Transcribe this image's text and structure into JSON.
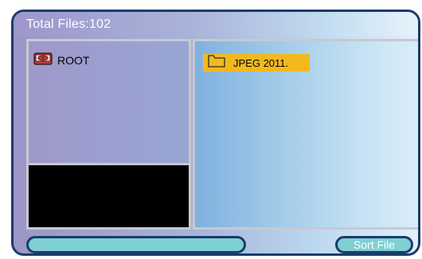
{
  "header": {
    "title": "Total Files:102"
  },
  "left_pane": {
    "root_label": "ROOT",
    "root_icon": "drive-icon"
  },
  "right_pane": {
    "items": [
      {
        "label": "JPEG 2011.",
        "icon": "folder-icon",
        "highlight": "#f2b91f"
      }
    ]
  },
  "footer": {
    "sort_button_label": "Sort File"
  },
  "colors": {
    "border": "#1b3c6b",
    "pill": "#7fcfd3",
    "preview": "#000000"
  }
}
